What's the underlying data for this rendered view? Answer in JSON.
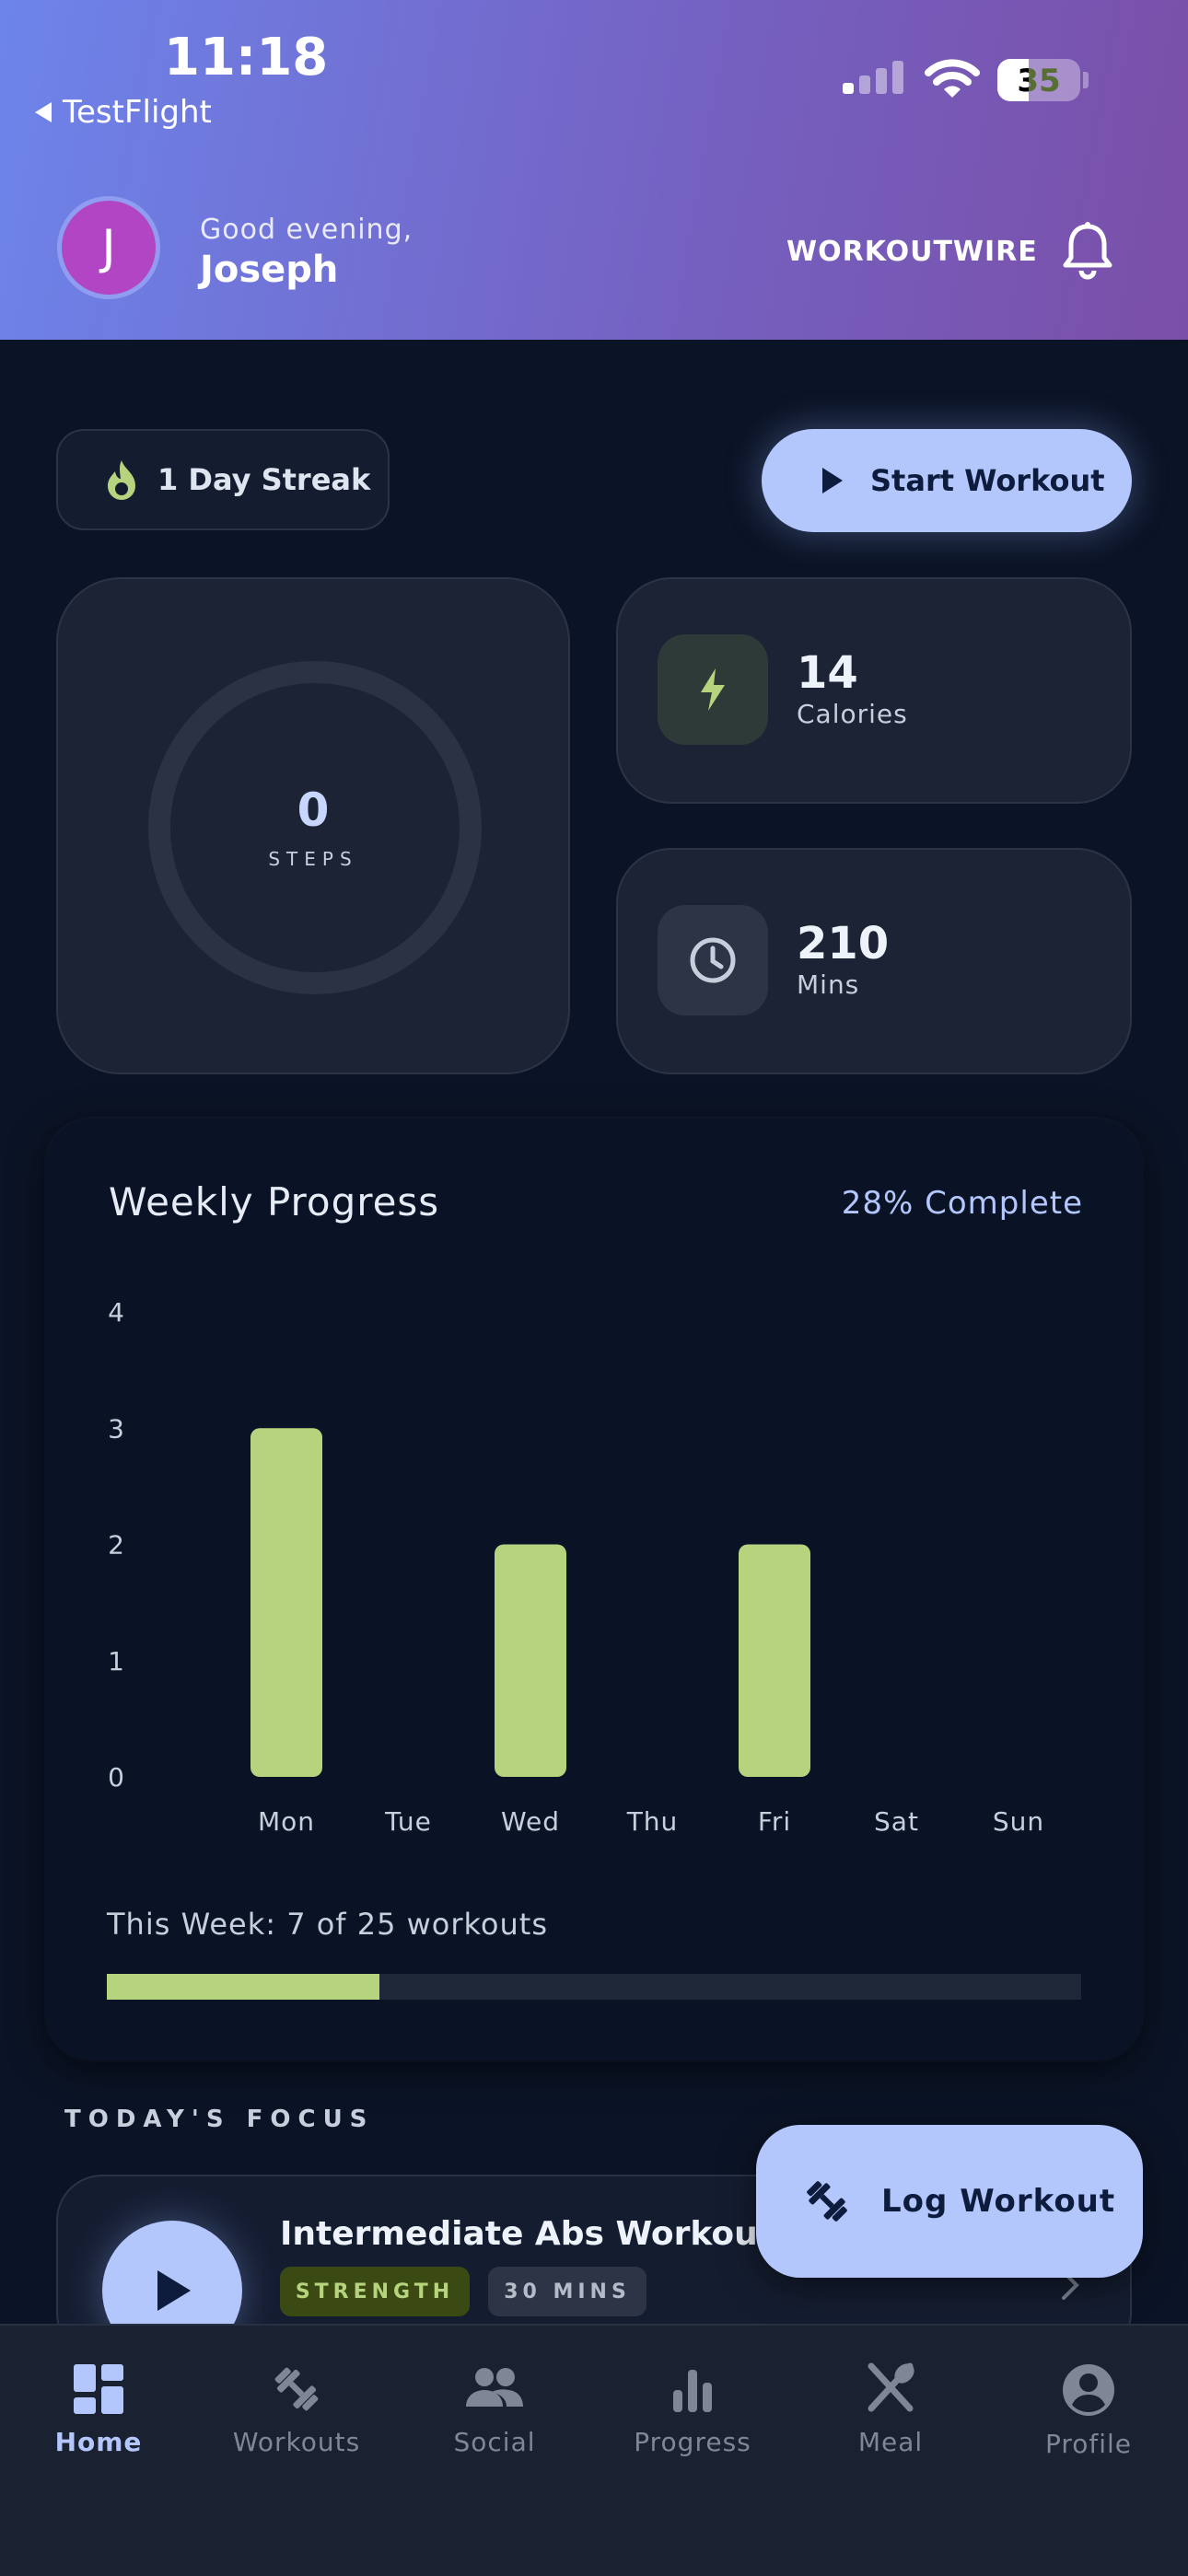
{
  "status_bar": {
    "time": "11:18",
    "back_label": "TestFlight",
    "battery": "35"
  },
  "header": {
    "avatar_initial": "J",
    "greeting": "Good evening,",
    "user_name": "Joseph",
    "brand": "WORKOUTWIRE"
  },
  "streak": {
    "label": "1 Day Streak"
  },
  "start_button": {
    "label": "Start Workout"
  },
  "stats": {
    "steps": {
      "value": "0",
      "label": "STEPS"
    },
    "calories": {
      "value": "14",
      "label": "Calories"
    },
    "minutes": {
      "value": "210",
      "label": "Mins"
    }
  },
  "weekly": {
    "title": "Weekly Progress",
    "percent_label": "28% Complete",
    "summary": "This Week: 7 of 25 workouts",
    "progress": 0.28
  },
  "chart_data": {
    "type": "bar",
    "categories": [
      "Mon",
      "Tue",
      "Wed",
      "Thu",
      "Fri",
      "Sat",
      "Sun"
    ],
    "values": [
      3,
      0,
      2,
      0,
      2,
      0,
      0
    ],
    "yticks": [
      0,
      1,
      2,
      3,
      4
    ],
    "ylim": [
      0,
      4
    ],
    "bar_color": "#b6d37d",
    "title": "",
    "xlabel": "",
    "ylabel": ""
  },
  "focus": {
    "section_title": "TODAY'S FOCUS",
    "workout_name": "Intermediate Abs Workout",
    "tag_type": "STRENGTH",
    "tag_duration": "30 MINS"
  },
  "log_button": {
    "label": "Log Workout"
  },
  "tabs": [
    {
      "label": "Home",
      "icon": "dashboard-icon",
      "active": true
    },
    {
      "label": "Workouts",
      "icon": "dumbbell-icon",
      "active": false
    },
    {
      "label": "Social",
      "icon": "people-icon",
      "active": false
    },
    {
      "label": "Progress",
      "icon": "bar-chart-icon",
      "active": false
    },
    {
      "label": "Meal",
      "icon": "utensils-icon",
      "active": false
    },
    {
      "label": "Profile",
      "icon": "account-icon",
      "active": false
    }
  ],
  "colors": {
    "accent": "#b3c7fd",
    "lime": "#b6d37d",
    "background": "#0b1426"
  }
}
